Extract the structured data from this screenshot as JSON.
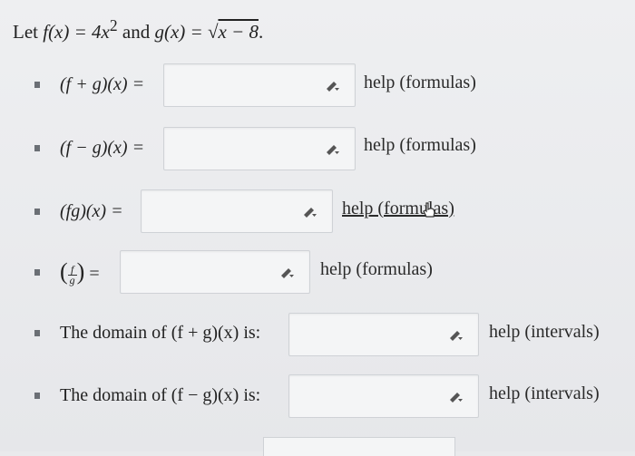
{
  "intro": {
    "prefix": "Let ",
    "f_def": "f(x) = 4x",
    "f_exp": "2",
    "and": " and ",
    "g_def": "g(x) = ",
    "sqrt_symbol": "√",
    "sqrt_arg": "x − 8",
    "end": "."
  },
  "rows": [
    {
      "label": "(f + g)(x) =",
      "help": "help (formulas)",
      "value": ""
    },
    {
      "label": "(f − g)(x) =",
      "help": "help (formulas)",
      "value": ""
    },
    {
      "label": "(fg)(x) =",
      "help": "help (formulas)",
      "value": ""
    },
    {
      "frac_num": "f",
      "frac_den": "g",
      "eq": "=",
      "help": "help (formulas)",
      "value": ""
    },
    {
      "label": "The domain of (f + g)(x) is:",
      "help": "help (intervals)",
      "value": ""
    },
    {
      "label": "The domain of (f − g)(x) is:",
      "help": "help (intervals)",
      "value": ""
    }
  ],
  "icons": {
    "edit": "pencil-icon",
    "cursor": "hand-cursor-icon"
  }
}
